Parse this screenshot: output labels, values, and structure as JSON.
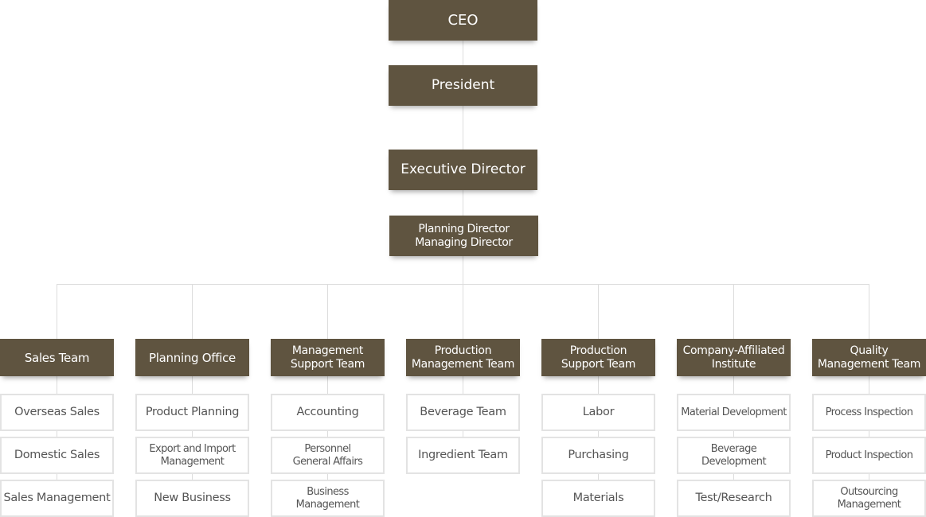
{
  "colors": {
    "box_fill": "#5f5440",
    "box_text": "#ffffff",
    "sub_border": "#e3e3e3",
    "sub_text": "#555555",
    "connector": "#dcdcdc"
  },
  "executives": [
    "CEO",
    "President",
    "Executive Director",
    "Planning Director\nManaging Director"
  ],
  "departments": [
    {
      "name": "Sales Team",
      "teams": [
        "Overseas Sales",
        "Domestic Sales",
        "Sales Management"
      ]
    },
    {
      "name": "Planning Office",
      "teams": [
        "Product Planning",
        "Export and Import\nManagement",
        "New Business"
      ]
    },
    {
      "name": "Management\nSupport Team",
      "teams": [
        "Accounting",
        "Personnel\nGeneral Affairs",
        "Business\nManagement"
      ]
    },
    {
      "name": "Production\nManagement Team",
      "teams": [
        "Beverage Team",
        "Ingredient Team"
      ]
    },
    {
      "name": "Production\nSupport Team",
      "teams": [
        "Labor",
        "Purchasing",
        "Materials"
      ]
    },
    {
      "name": "Company-Affiliated\nInstitute",
      "teams": [
        "Material Development",
        "Beverage\nDevelopment",
        "Test/Research"
      ]
    },
    {
      "name": "Quality\nManagement Team",
      "teams": [
        "Process Inspection",
        "Product Inspection",
        "Outsourcing\nManagement"
      ]
    }
  ]
}
